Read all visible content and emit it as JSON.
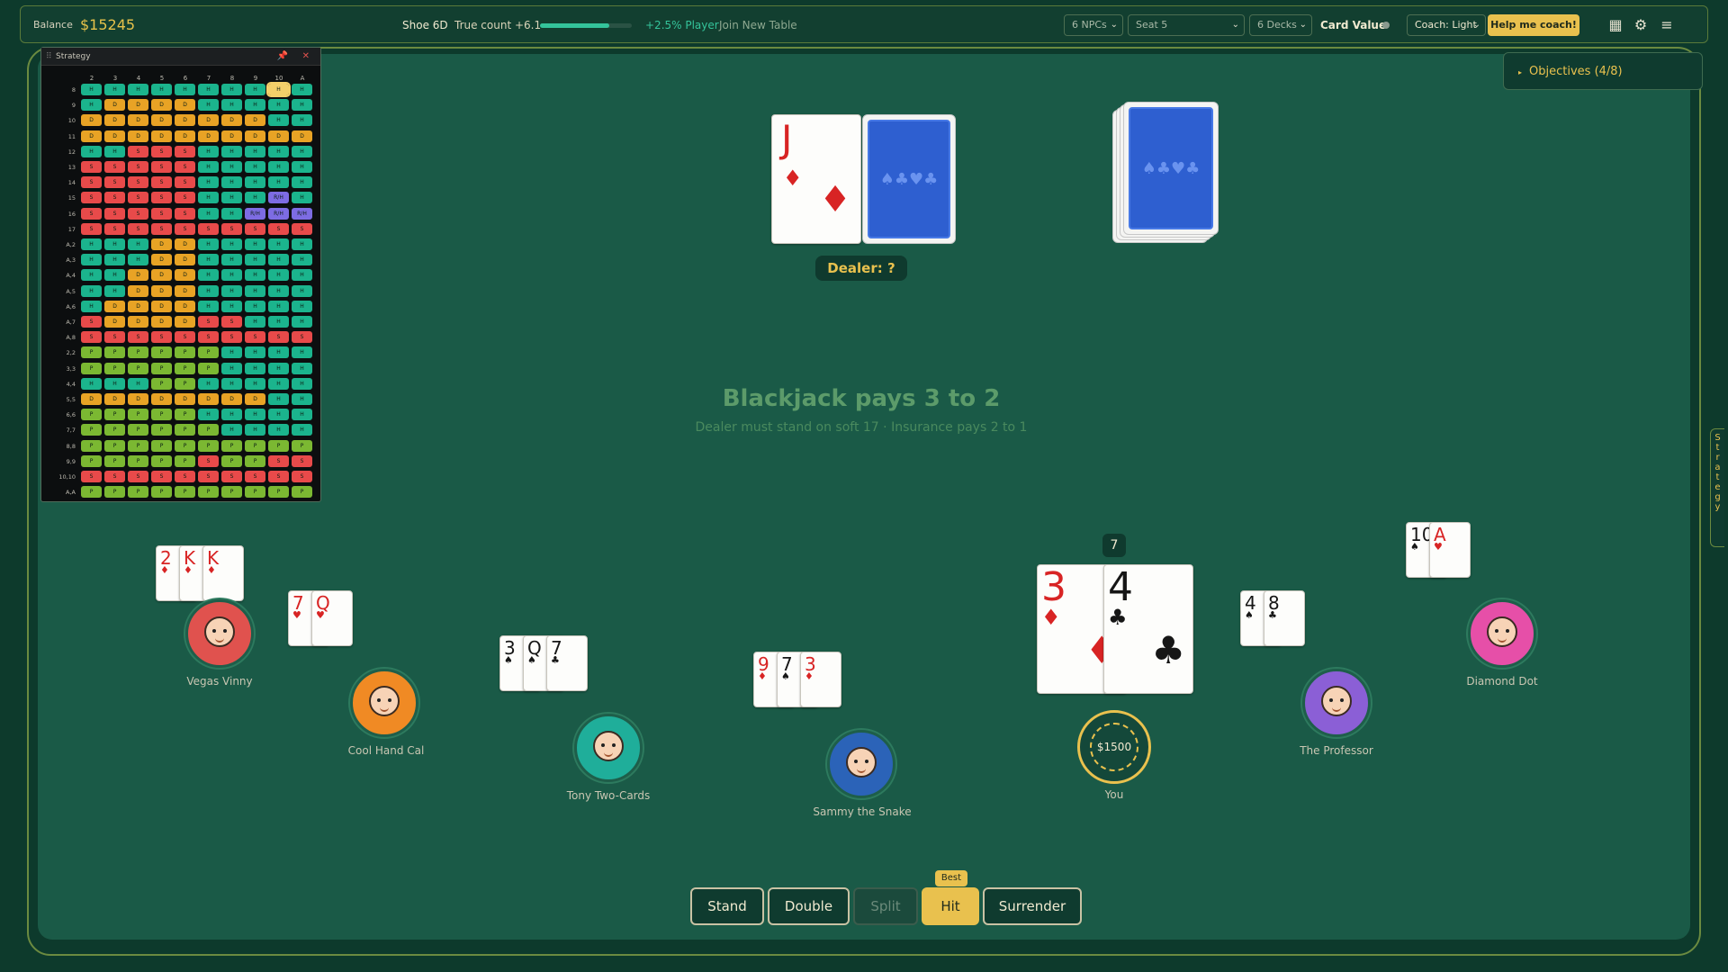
{
  "topbar": {
    "balance_label": "Balance",
    "balance_value": "$15245",
    "shoe": "Shoe 6D",
    "true_count": "True count +6.1",
    "true_count_level": 0.75,
    "edge": "+2.5% Player",
    "join": "Join New Table",
    "npcs": "6 NPCs",
    "seat": "Seat 5",
    "decks": "6 Decks",
    "card_value": "Card Value",
    "coach": "Coach: Light",
    "help": "Help me coach!",
    "icons": [
      "grid-icon",
      "gear-icon",
      "menu-icon"
    ]
  },
  "strategy": {
    "title": "Strategy",
    "columns": [
      "2",
      "3",
      "4",
      "5",
      "6",
      "7",
      "8",
      "9",
      "10",
      "A"
    ],
    "highlight": {
      "row": "8",
      "col": "10"
    },
    "rows": [
      {
        "label": "8",
        "cells": [
          "H",
          "H",
          "H",
          "H",
          "H",
          "H",
          "H",
          "H",
          "H",
          "H"
        ]
      },
      {
        "label": "9",
        "cells": [
          "H",
          "D",
          "D",
          "D",
          "D",
          "H",
          "H",
          "H",
          "H",
          "H"
        ]
      },
      {
        "label": "10",
        "cells": [
          "D",
          "D",
          "D",
          "D",
          "D",
          "D",
          "D",
          "D",
          "H",
          "H"
        ]
      },
      {
        "label": "11",
        "cells": [
          "D",
          "D",
          "D",
          "D",
          "D",
          "D",
          "D",
          "D",
          "D",
          "D"
        ]
      },
      {
        "label": "12",
        "cells": [
          "H",
          "H",
          "S",
          "S",
          "S",
          "H",
          "H",
          "H",
          "H",
          "H"
        ]
      },
      {
        "label": "13",
        "cells": [
          "S",
          "S",
          "S",
          "S",
          "S",
          "H",
          "H",
          "H",
          "H",
          "H"
        ]
      },
      {
        "label": "14",
        "cells": [
          "S",
          "S",
          "S",
          "S",
          "S",
          "H",
          "H",
          "H",
          "H",
          "H"
        ]
      },
      {
        "label": "15",
        "cells": [
          "S",
          "S",
          "S",
          "S",
          "S",
          "H",
          "H",
          "H",
          "R/H",
          "H"
        ]
      },
      {
        "label": "16",
        "cells": [
          "S",
          "S",
          "S",
          "S",
          "S",
          "H",
          "H",
          "R/H",
          "R/H",
          "R/H"
        ]
      },
      {
        "label": "17",
        "cells": [
          "S",
          "S",
          "S",
          "S",
          "S",
          "S",
          "S",
          "S",
          "S",
          "S"
        ]
      },
      {
        "label": "A,2",
        "cells": [
          "H",
          "H",
          "H",
          "D",
          "D",
          "H",
          "H",
          "H",
          "H",
          "H"
        ]
      },
      {
        "label": "A,3",
        "cells": [
          "H",
          "H",
          "H",
          "D",
          "D",
          "H",
          "H",
          "H",
          "H",
          "H"
        ]
      },
      {
        "label": "A,4",
        "cells": [
          "H",
          "H",
          "D",
          "D",
          "D",
          "H",
          "H",
          "H",
          "H",
          "H"
        ]
      },
      {
        "label": "A,5",
        "cells": [
          "H",
          "H",
          "D",
          "D",
          "D",
          "H",
          "H",
          "H",
          "H",
          "H"
        ]
      },
      {
        "label": "A,6",
        "cells": [
          "H",
          "D",
          "D",
          "D",
          "D",
          "H",
          "H",
          "H",
          "H",
          "H"
        ]
      },
      {
        "label": "A,7",
        "cells": [
          "S",
          "D",
          "D",
          "D",
          "D",
          "S",
          "S",
          "H",
          "H",
          "H"
        ]
      },
      {
        "label": "A,8",
        "cells": [
          "S",
          "S",
          "S",
          "S",
          "S",
          "S",
          "S",
          "S",
          "S",
          "S"
        ]
      },
      {
        "label": "2,2",
        "cells": [
          "P",
          "P",
          "P",
          "P",
          "P",
          "P",
          "H",
          "H",
          "H",
          "H"
        ]
      },
      {
        "label": "3,3",
        "cells": [
          "P",
          "P",
          "P",
          "P",
          "P",
          "P",
          "H",
          "H",
          "H",
          "H"
        ]
      },
      {
        "label": "4,4",
        "cells": [
          "H",
          "H",
          "H",
          "P",
          "P",
          "H",
          "H",
          "H",
          "H",
          "H"
        ]
      },
      {
        "label": "5,5",
        "cells": [
          "D",
          "D",
          "D",
          "D",
          "D",
          "D",
          "D",
          "D",
          "H",
          "H"
        ]
      },
      {
        "label": "6,6",
        "cells": [
          "P",
          "P",
          "P",
          "P",
          "P",
          "H",
          "H",
          "H",
          "H",
          "H"
        ]
      },
      {
        "label": "7,7",
        "cells": [
          "P",
          "P",
          "P",
          "P",
          "P",
          "P",
          "H",
          "H",
          "H",
          "H"
        ]
      },
      {
        "label": "8,8",
        "cells": [
          "P",
          "P",
          "P",
          "P",
          "P",
          "P",
          "P",
          "P",
          "P",
          "P"
        ]
      },
      {
        "label": "9,9",
        "cells": [
          "P",
          "P",
          "P",
          "P",
          "P",
          "S",
          "P",
          "P",
          "S",
          "S"
        ]
      },
      {
        "label": "10,10",
        "cells": [
          "S",
          "S",
          "S",
          "S",
          "S",
          "S",
          "S",
          "S",
          "S",
          "S"
        ]
      },
      {
        "label": "A,A",
        "cells": [
          "P",
          "P",
          "P",
          "P",
          "P",
          "P",
          "P",
          "P",
          "P",
          "P"
        ]
      }
    ]
  },
  "dealer": {
    "label": "Dealer: ?",
    "up_card": {
      "rank": "J",
      "suit": "♦"
    }
  },
  "rules": {
    "title": "Blackjack pays 3 to 2",
    "subtitle": "Dealer must stand on soft 17 · Insurance pays 2 to 1"
  },
  "objectives": "Objectives (4/8)",
  "side_tab": "Strategy",
  "players": [
    {
      "name": "Vegas Vinny",
      "color": "#e0524e",
      "cards": [
        {
          "rank": "2",
          "suit": "♦"
        },
        {
          "rank": "K",
          "suit": "♦"
        },
        {
          "rank": "K",
          "suit": "♦"
        }
      ]
    },
    {
      "name": "Cool Hand Cal",
      "color": "#f08a24",
      "cards": [
        {
          "rank": "7",
          "suit": "♥"
        },
        {
          "rank": "Q",
          "suit": "♥"
        }
      ]
    },
    {
      "name": "Tony Two-Cards",
      "color": "#1fae9a",
      "cards": [
        {
          "rank": "3",
          "suit": "♠"
        },
        {
          "rank": "Q",
          "suit": "♠"
        },
        {
          "rank": "7",
          "suit": "♣"
        }
      ]
    },
    {
      "name": "Sammy the Snake",
      "color": "#2b63b8",
      "cards": [
        {
          "rank": "9",
          "suit": "♦"
        },
        {
          "rank": "7",
          "suit": "♠"
        },
        {
          "rank": "3",
          "suit": "♦"
        }
      ]
    },
    {
      "name": "The Professor",
      "color": "#8b5fd6",
      "cards": [
        {
          "rank": "4",
          "suit": "♠"
        },
        {
          "rank": "8",
          "suit": "♣"
        }
      ]
    },
    {
      "name": "Diamond Dot",
      "color": "#e64fa8",
      "cards": [
        {
          "rank": "10",
          "suit": "♠"
        },
        {
          "rank": "A",
          "suit": "♥"
        }
      ]
    }
  ],
  "you": {
    "name": "You",
    "bet": "$1500",
    "total": "7",
    "cards": [
      {
        "rank": "3",
        "suit": "♦"
      },
      {
        "rank": "4",
        "suit": "♣"
      }
    ]
  },
  "actions": {
    "stand": "Stand",
    "double": "Double",
    "split": "Split",
    "hit": "Hit",
    "surrender": "Surrender",
    "best_tag": "Best"
  }
}
